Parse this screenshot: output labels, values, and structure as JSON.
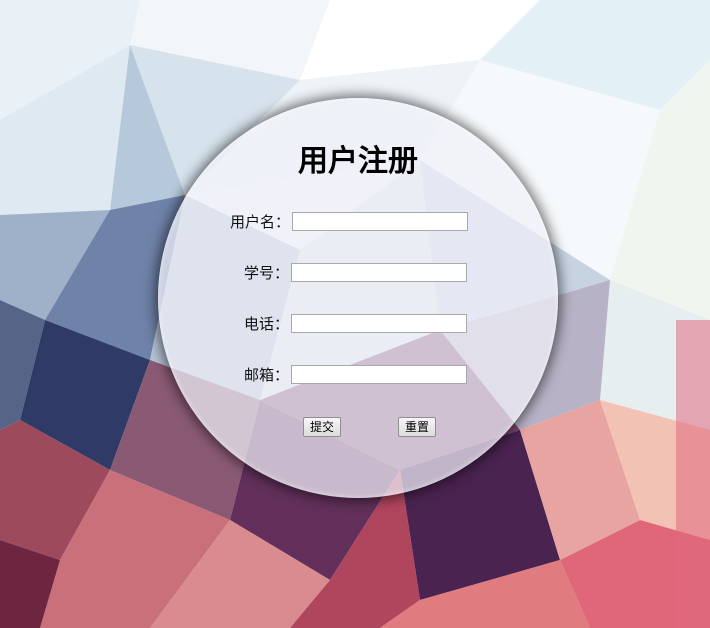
{
  "form": {
    "title": "用户注册",
    "fields": [
      {
        "label": "用户名：",
        "value": "",
        "placeholder": ""
      },
      {
        "label": "学号：",
        "value": "",
        "placeholder": ""
      },
      {
        "label": "电话：",
        "value": "",
        "placeholder": ""
      },
      {
        "label": "邮箱：",
        "value": "",
        "placeholder": ""
      }
    ],
    "submit_label": "提交",
    "reset_label": "重置"
  },
  "colors": {
    "overlay": "#f0f0f8",
    "title_text": "#000000"
  }
}
